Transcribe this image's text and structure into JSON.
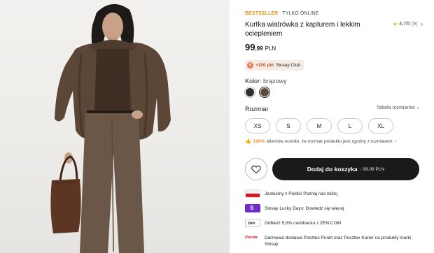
{
  "product": {
    "badge_bestseller": "BESTSELLER",
    "badge_online": "TYLKO ONLINE",
    "title": "Kurtka wiatrówka z kapturem i lekkim ociepleniem",
    "rating": {
      "score": "4,7/5",
      "count": "(9)"
    },
    "price": {
      "main": "99",
      "decimal": ",99",
      "currency": "PLN"
    },
    "club_points": {
      "points": "+100 pkt",
      "label": "Sinsay Club"
    },
    "color": {
      "label": "Kolor:",
      "value": "brązowy",
      "swatches": [
        "#2e2e30",
        "#5a4a3e"
      ]
    },
    "size": {
      "label": "Rozmiar",
      "guide_link": "Tabela rozmiarów",
      "options": [
        "XS",
        "S",
        "M",
        "L",
        "XL"
      ]
    },
    "fit_note": {
      "percent": "100%",
      "text": "klientów oceniło, że rozmiar produktu jest zgodny z rozmiarem"
    },
    "add_to_cart": {
      "label": "Dodaj do koszyka",
      "price": "- 99,99 PLN"
    }
  },
  "promos": [
    {
      "icon": "polish-flag-icon",
      "text": "Jesteśmy z Polski! Poznaj nas bliżej"
    },
    {
      "icon": "sinsay-lucky-days-icon",
      "text": "Sinsay Lucky Days: Dowiedz się więcej"
    },
    {
      "icon": "zen-logo-icon",
      "text": "Odbierz 5,5% cashbacku z ZEN.COM"
    },
    {
      "icon": "poczta-polska-logo-icon",
      "text": "Darmowa dostawa Pocztex Punkt oraz Pocztex Kurier na produkty marki Sinsay"
    }
  ]
}
